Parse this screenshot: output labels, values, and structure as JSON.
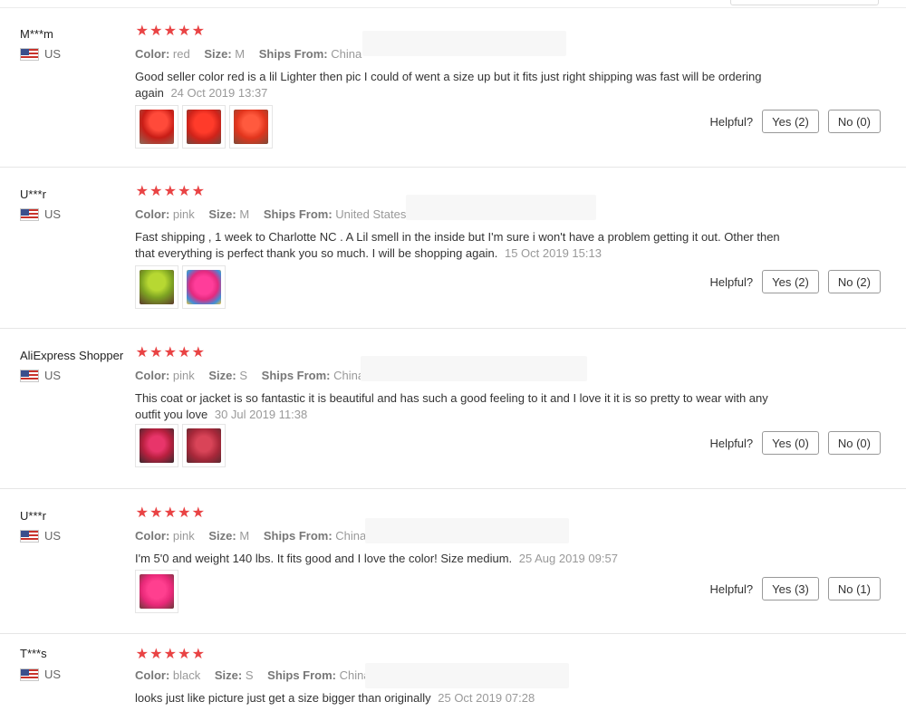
{
  "reviews": [
    {
      "user": "M***m",
      "country": "US",
      "rating": 5,
      "color": "red",
      "size": "M",
      "ships_from": "China",
      "text": "Good seller color red is a lil Lighter then pic I could of went a size up but it fits just right shipping was fast will be ordering again",
      "date": "24 Oct 2019 13:37",
      "helpful_label": "Helpful?",
      "yes": "Yes (2)",
      "no": "No (0)",
      "photos": [
        "#d8261f",
        "#e52a1c",
        "#e8381e"
      ]
    },
    {
      "user": "U***r",
      "country": "US",
      "rating": 5,
      "color": "pink",
      "size": "M",
      "ships_from": "United States",
      "text": "Fast shipping , 1 week to Charlotte NC . A Lil smell in the inside but I'm sure i won't have a problem getting it out. Other then that everything is perfect thank you so much. I will be shopping again.",
      "date": "15 Oct 2019 15:13",
      "helpful_label": "Helpful?",
      "yes": "Yes (2)",
      "no": "No (2)",
      "photos": [
        "#8fb82b",
        "#e8308c"
      ]
    },
    {
      "user": "AliExpress Shopper",
      "country": "US",
      "rating": 5,
      "color": "pink",
      "size": "S",
      "ships_from": "China",
      "text": "This coat or jacket is so fantastic it is beautiful and has such a good feeling to it and I love it it is so pretty to wear with any outfit you love",
      "date": "30 Jul 2019 11:38",
      "helpful_label": "Helpful?",
      "yes": "Yes (0)",
      "no": "No (0)",
      "photos": [
        "#c82a4a",
        "#c23648"
      ]
    },
    {
      "user": "U***r",
      "country": "US",
      "rating": 5,
      "color": "pink",
      "size": "M",
      "ships_from": "China",
      "text": "I'm 5'0 and weight 140 lbs. It fits good and I love the color! Size medium.",
      "date": "25 Aug 2019 09:57",
      "helpful_label": "Helpful?",
      "yes": "Yes (3)",
      "no": "No (1)",
      "photos": [
        "#f0357f"
      ]
    },
    {
      "user": "T***s",
      "country": "US",
      "rating": 5,
      "color": "black",
      "size": "S",
      "ships_from": "China",
      "text": "looks just like picture just get a size bigger than originally",
      "date": "25 Oct 2019 07:28",
      "photos": []
    }
  ],
  "labels": {
    "color": "Color:",
    "size": "Size:",
    "ships_from": "Ships From:"
  }
}
